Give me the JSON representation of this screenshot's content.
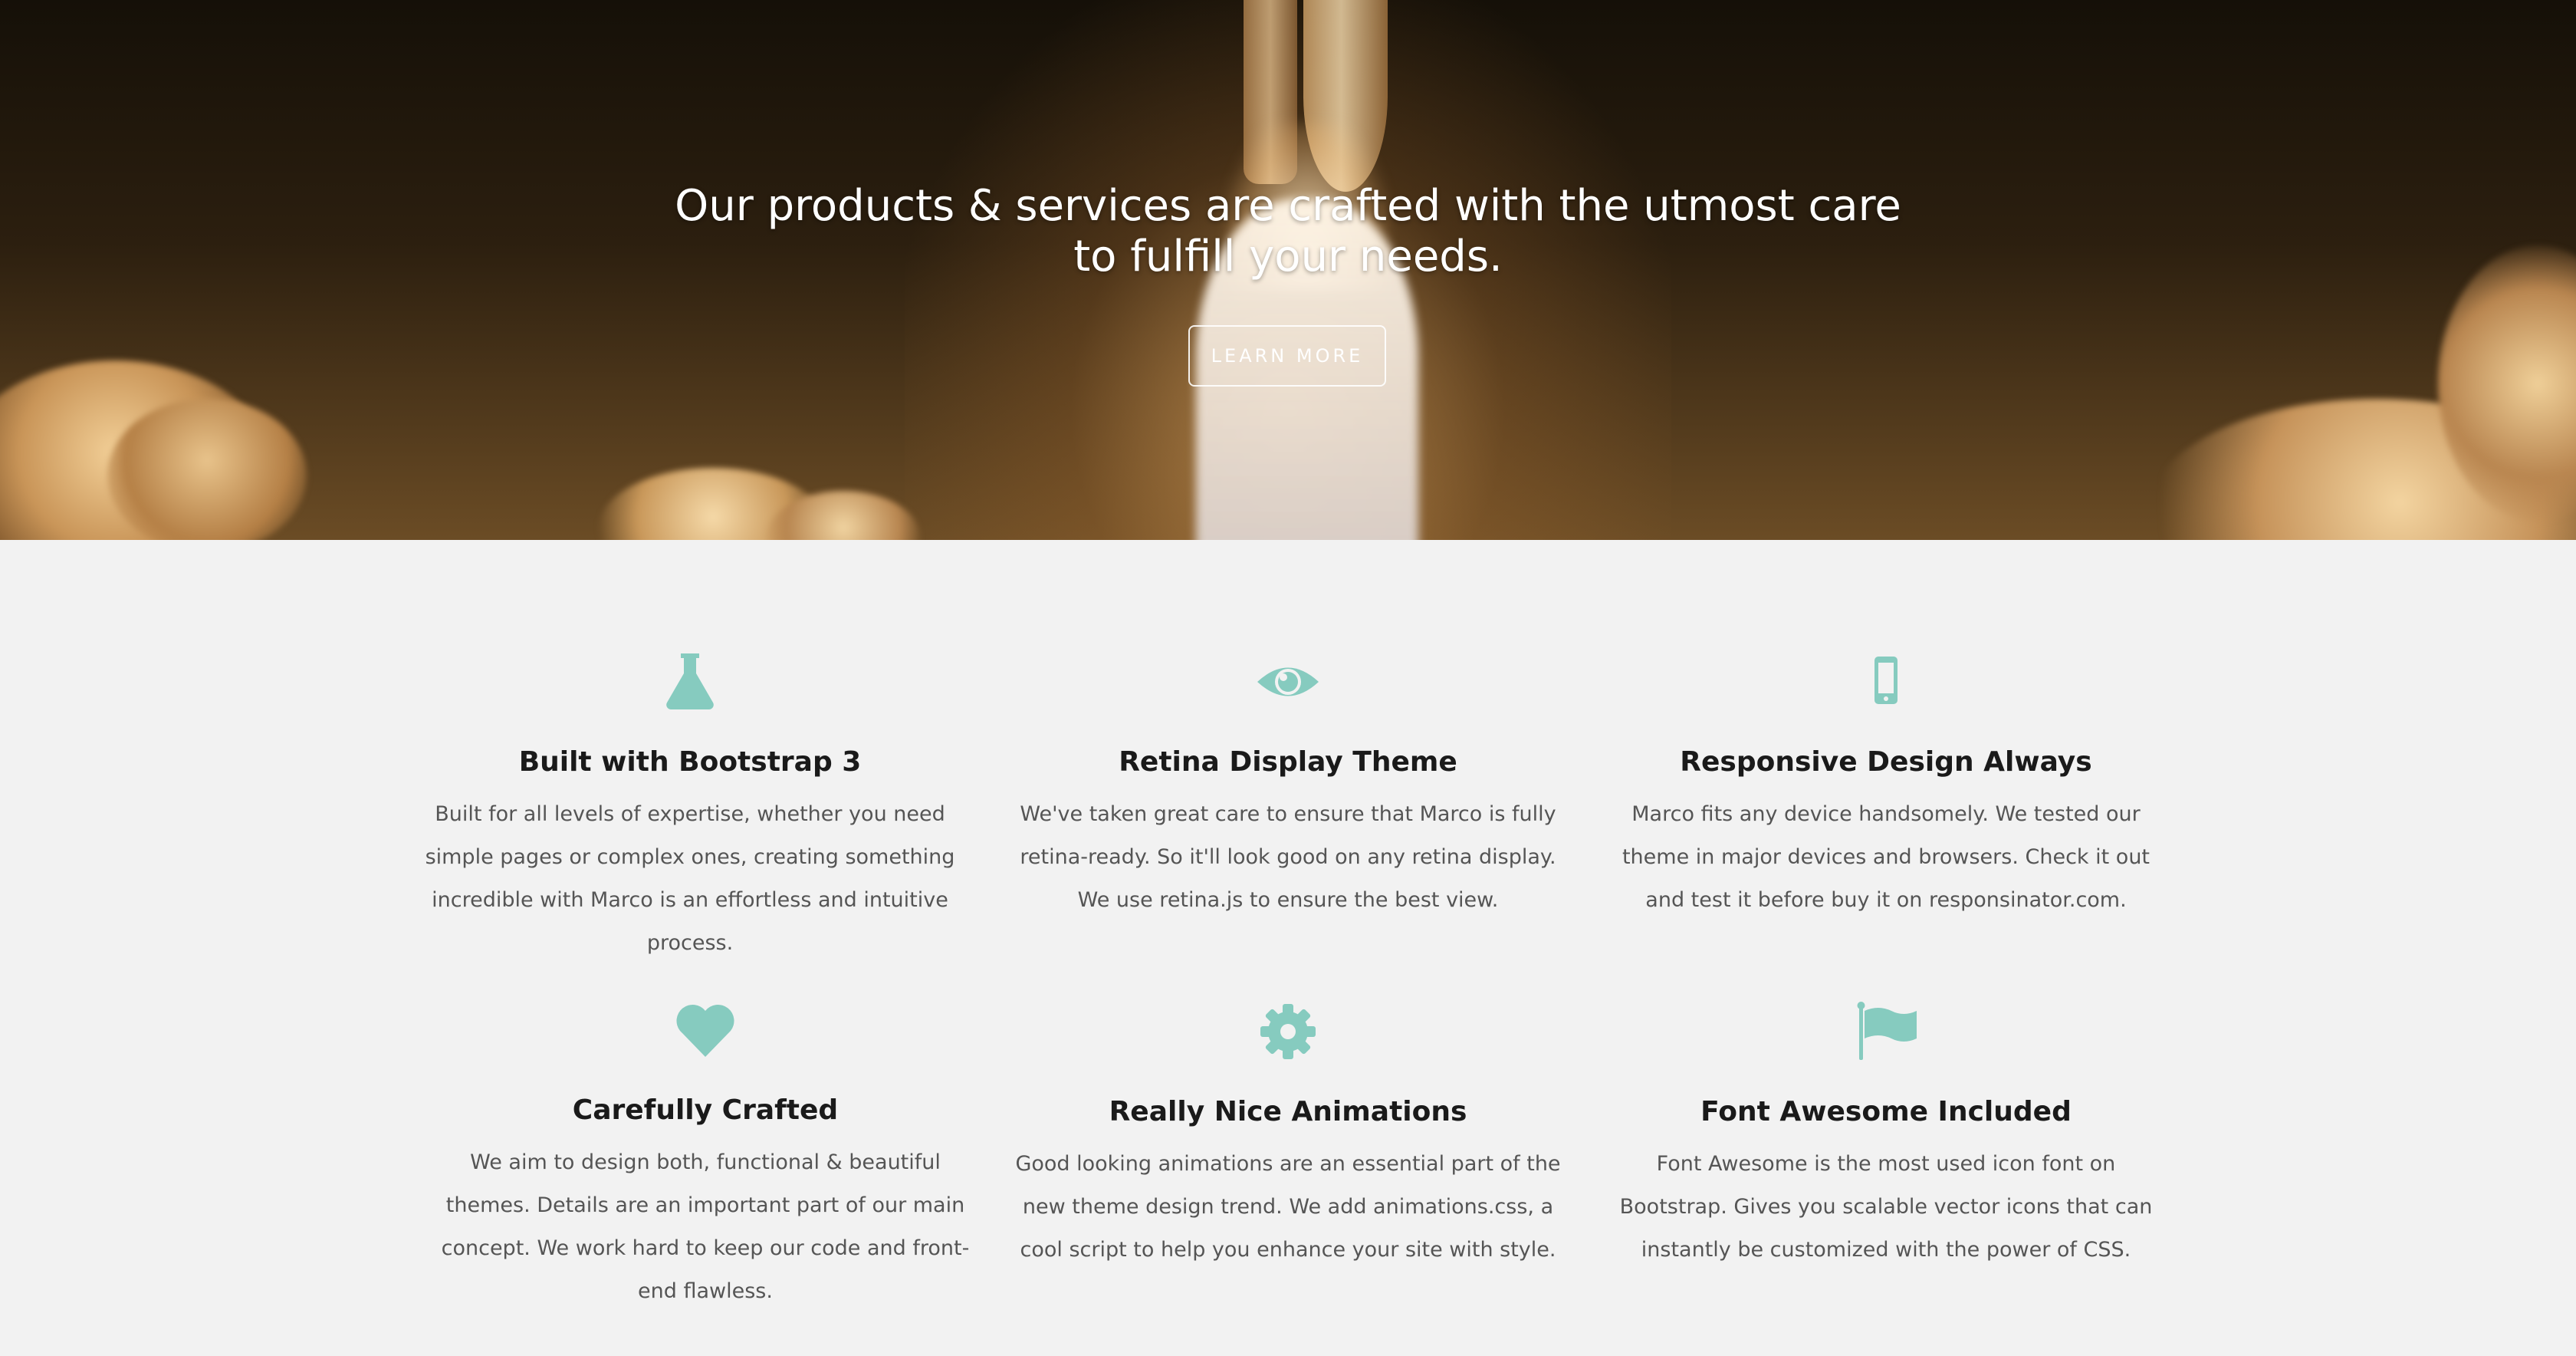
{
  "hero": {
    "title": "Our products & services are crafted with the utmost care to fulfill your needs.",
    "button_label": "LEARN MORE"
  },
  "colors": {
    "accent": "#86cbbf",
    "heading": "#1a1a1a",
    "body_text": "#555555",
    "background": "#f2f2f2"
  },
  "features": [
    {
      "icon": "flask-icon",
      "title": "Built with Bootstrap 3",
      "text": "Built for all levels of expertise, whether you need simple pages or complex ones, creating something incredible with Marco is an effortless and intuitive process."
    },
    {
      "icon": "eye-icon",
      "title": "Retina Display Theme",
      "text": "We've taken great care to ensure that Marco is fully retina-ready. So it'll look good on any retina display. We use retina.js to ensure the best view."
    },
    {
      "icon": "mobile-icon",
      "title": "Responsive Design Always",
      "text": "Marco fits any device handsomely. We tested our theme in major devices and browsers. Check it out and test it before buy it on responsinator.com."
    },
    {
      "icon": "heart-icon",
      "title": "Carefully Crafted",
      "text": "We aim to design both, functional & beautiful themes. Details are an important part of our main concept. We work hard to keep our code and front-end flawless."
    },
    {
      "icon": "gear-icon",
      "title": "Really Nice Animations",
      "text": "Good looking animations are an essential part of the new theme design trend. We add animations.css, a cool script to help you enhance your site with style."
    },
    {
      "icon": "flag-icon",
      "title": "Font Awesome Included",
      "text": "Font Awesome is the most used icon font on Bootstrap. Gives you scalable vector icons that can instantly be customized with the power of CSS."
    }
  ]
}
